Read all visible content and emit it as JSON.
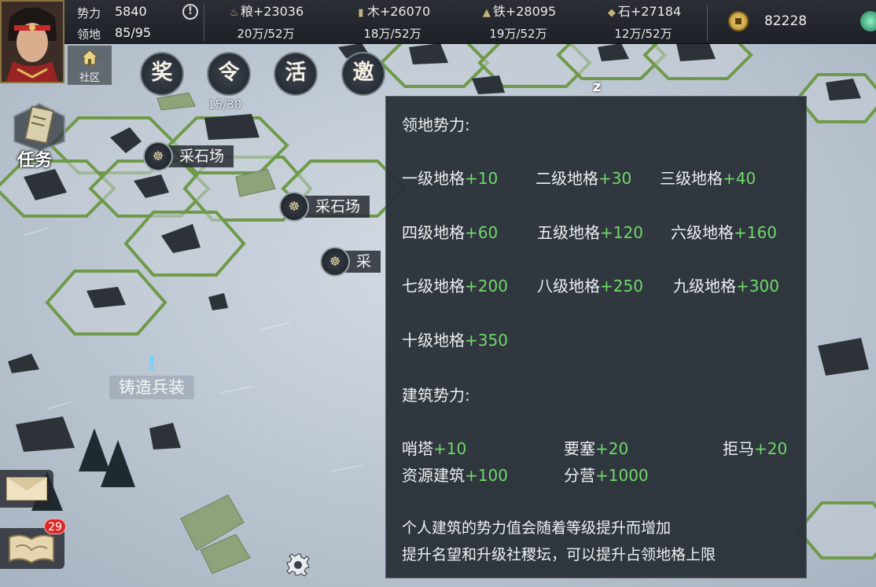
{
  "top": {
    "power_label": "势力",
    "power_value": "5840",
    "territory_label": "领地",
    "territory_value": "85/95",
    "info_icon": "exclamation-icon",
    "resources": [
      {
        "name": "粮",
        "delta": "+23036",
        "stock": "20万/52万",
        "icon": "wheat-icon"
      },
      {
        "name": "木",
        "delta": "+26070",
        "stock": "18万/52万",
        "icon": "wood-icon"
      },
      {
        "name": "铁",
        "delta": "+28095",
        "stock": "19万/52万",
        "icon": "iron-icon"
      },
      {
        "name": "石",
        "delta": "+27184",
        "stock": "12万/52万",
        "icon": "stone-icon"
      }
    ],
    "coins": "82228"
  },
  "community_label": "社区",
  "round_buttons": [
    "奖",
    "令",
    "活",
    "邀"
  ],
  "order_count": "15/30",
  "task_label": "任务",
  "map_labels": [
    "采石场",
    "采石场",
    "采"
  ],
  "forge_label": "铸造兵装",
  "mail_badge": "29",
  "sleep_indicator": "z",
  "panel": {
    "territory_title": "领地势力:",
    "territory_levels": [
      {
        "label": "一级地格",
        "value": "+10"
      },
      {
        "label": "二级地格",
        "value": "+30"
      },
      {
        "label": "三级地格",
        "value": "+40"
      },
      {
        "label": "四级地格",
        "value": "+60"
      },
      {
        "label": "五级地格",
        "value": "+120"
      },
      {
        "label": "六级地格",
        "value": "+160"
      },
      {
        "label": "七级地格",
        "value": "+200"
      },
      {
        "label": "八级地格",
        "value": "+250"
      },
      {
        "label": "九级地格",
        "value": "+300"
      },
      {
        "label": "十级地格",
        "value": "+350"
      }
    ],
    "building_title": "建筑势力:",
    "buildings": [
      {
        "label": "哨塔",
        "value": "+10"
      },
      {
        "label": "要塞",
        "value": "+20"
      },
      {
        "label": "拒马",
        "value": "+20"
      },
      {
        "label": "资源建筑",
        "value": "+100"
      },
      {
        "label": "分营",
        "value": "+1000"
      }
    ],
    "note_1": "个人建筑的势力值会随着等级提升而增加",
    "note_2": "提升名望和升级社稷坛，可以提升占领地格上限"
  }
}
